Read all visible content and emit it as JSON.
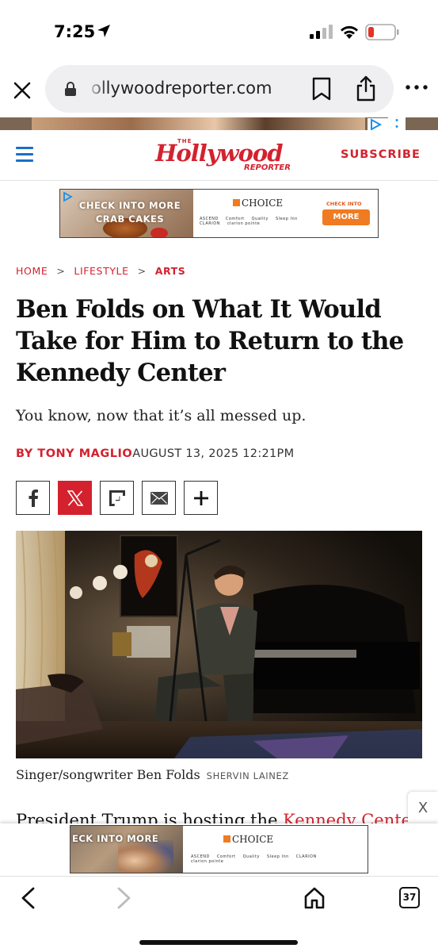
{
  "status_bar": {
    "time": "7:25",
    "icons": [
      "location-arrow-icon",
      "cellular-signal-icon",
      "wifi-icon",
      "battery-low-icon"
    ],
    "battery_color": "#e5332a"
  },
  "browser": {
    "url": "ollywoodreporter.com",
    "icons": [
      "close-icon",
      "lock-icon",
      "bookmark-icon",
      "share-icon",
      "more-icon"
    ]
  },
  "site": {
    "logo_the": "THE",
    "logo_main": "Hollywood",
    "logo_sub": "REPORTER",
    "subscribe_label": "SUBSCRIBE",
    "brand_color": "#d3222e",
    "menu_icon": "hamburger-menu-icon"
  },
  "ad_banner": {
    "headline": "CHECK INTO MORE CRAB CAKES",
    "sponsor": "CHOICE",
    "brands": [
      "ASCEND",
      "Comfort",
      "Quality",
      "Sleep Inn",
      "CLARION",
      "clarion pointe"
    ],
    "cta_top": "CHECK INTO",
    "cta_button": "MORE"
  },
  "breadcrumb": {
    "home": "HOME",
    "section": "LIFESTYLE",
    "current": "ARTS",
    "separator": ">"
  },
  "article": {
    "headline": "Ben Folds on What It Would Take for Him to Return to the Kennedy Center",
    "dek": "You know, now that it’s all messed up.",
    "author": "BY TONY MAGLIO",
    "date": "AUGUST 13, 2025 12:21PM",
    "share_icons": [
      "facebook-icon",
      "x-icon",
      "flipboard-icon",
      "email-icon",
      "plus-icon"
    ],
    "image_caption": "Singer/songwriter Ben Folds",
    "image_credit": "SHERVIN LAINEZ",
    "body_start": "President Trump is hosting the ",
    "body_link": "Kennedy Center"
  },
  "sticky_ad": {
    "headline": "ECK INTO MORE",
    "sponsor": "CHOICE",
    "brands": [
      "ASCEND",
      "Comfort",
      "Quality",
      "Sleep Inn",
      "CLARION",
      "clarion pointe"
    ],
    "close_label": "X"
  },
  "toolbar": {
    "tab_count": "37",
    "icons": [
      "back-arrow-icon",
      "forward-arrow-icon",
      "home-icon",
      "tabs-icon"
    ]
  }
}
